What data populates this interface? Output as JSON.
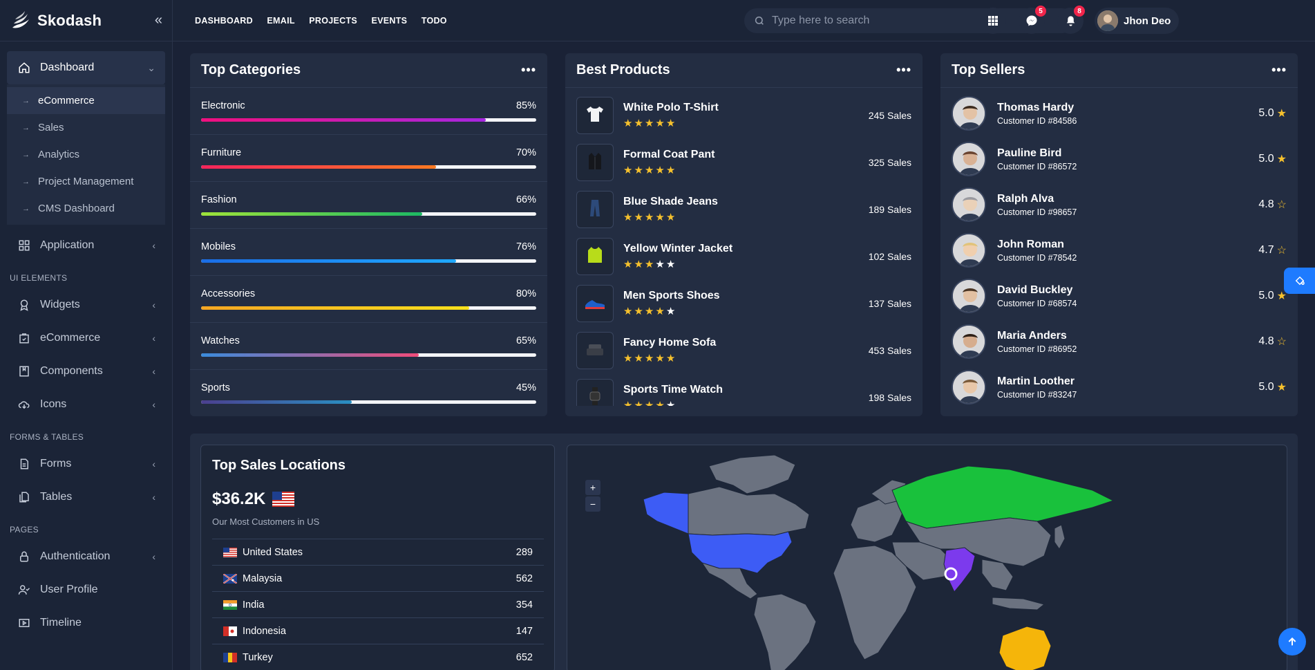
{
  "brand": {
    "name": "Skodash"
  },
  "header": {
    "nav": [
      "DASHBOARD",
      "EMAIL",
      "PROJECTS",
      "EVENTS",
      "TODO"
    ],
    "search_placeholder": "Type here to search",
    "user_name": "Jhon Deo",
    "messages_badge": "5",
    "notifications_badge": "8"
  },
  "sidebar": {
    "dashboard": "Dashboard",
    "dashboard_sub": [
      "eCommerce",
      "Sales",
      "Analytics",
      "Project Management",
      "CMS Dashboard"
    ],
    "application": "Application",
    "section_ui": "UI ELEMENTS",
    "widgets": "Widgets",
    "ecommerce": "eCommerce",
    "components": "Components",
    "icons": "Icons",
    "section_forms": "FORMS & TABLES",
    "forms": "Forms",
    "tables": "Tables",
    "section_pages": "PAGES",
    "authentication": "Authentication",
    "user_profile": "User Profile",
    "timeline": "Timeline"
  },
  "top_categories": {
    "title": "Top Categories",
    "items": [
      {
        "name": "Electronic",
        "pct": "85%",
        "value": 85,
        "gradient": "linear-gradient(90deg,#f10f7e,#a626e0)"
      },
      {
        "name": "Furniture",
        "pct": "70%",
        "value": 70,
        "gradient": "linear-gradient(90deg,#f3245b,#ff7a22)"
      },
      {
        "name": "Fashion",
        "pct": "66%",
        "value": 66,
        "gradient": "linear-gradient(90deg,#9ee33a,#1db964)"
      },
      {
        "name": "Mobiles",
        "pct": "76%",
        "value": 76,
        "gradient": "linear-gradient(90deg,#1a6de6,#1fa8ff)"
      },
      {
        "name": "Accessories",
        "pct": "80%",
        "value": 80,
        "gradient": "linear-gradient(90deg,#f5a623,#f6e01c)"
      },
      {
        "name": "Watches",
        "pct": "65%",
        "value": 65,
        "gradient": "linear-gradient(90deg,#3a8bdc,#f04c7a)"
      },
      {
        "name": "Sports",
        "pct": "45%",
        "value": 45,
        "gradient": "linear-gradient(90deg,#4b3f8f,#2a8fc2)"
      }
    ]
  },
  "best_products": {
    "title": "Best Products",
    "items": [
      {
        "name": "White Polo T-Shirt",
        "sales": "245 Sales",
        "stars": 5,
        "icon": "tshirt-icon"
      },
      {
        "name": "Formal Coat Pant",
        "sales": "325 Sales",
        "stars": 5,
        "icon": "coat-icon"
      },
      {
        "name": "Blue Shade Jeans",
        "sales": "189 Sales",
        "stars": 5,
        "icon": "jeans-icon"
      },
      {
        "name": "Yellow Winter Jacket",
        "sales": "102 Sales",
        "stars": 3,
        "icon": "jacket-icon"
      },
      {
        "name": "Men Sports Shoes",
        "sales": "137 Sales",
        "stars": 4,
        "icon": "shoe-icon"
      },
      {
        "name": "Fancy Home Sofa",
        "sales": "453 Sales",
        "stars": 5,
        "icon": "sofa-icon"
      },
      {
        "name": "Sports Time Watch",
        "sales": "198 Sales",
        "stars": 4,
        "icon": "watch-icon"
      }
    ]
  },
  "top_sellers": {
    "title": "Top Sellers",
    "items": [
      {
        "name": "Thomas Hardy",
        "id": "Customer ID #84586",
        "rating": "5.0",
        "half": false
      },
      {
        "name": "Pauline Bird",
        "id": "Customer ID #86572",
        "rating": "5.0",
        "half": false
      },
      {
        "name": "Ralph Alva",
        "id": "Customer ID #98657",
        "rating": "4.8",
        "half": true
      },
      {
        "name": "John Roman",
        "id": "Customer ID #78542",
        "rating": "4.7",
        "half": true
      },
      {
        "name": "David Buckley",
        "id": "Customer ID #68574",
        "rating": "5.0",
        "half": false
      },
      {
        "name": "Maria Anders",
        "id": "Customer ID #86952",
        "rating": "4.8",
        "half": true
      },
      {
        "name": "Martin Loother",
        "id": "Customer ID #83247",
        "rating": "5.0",
        "half": false
      }
    ]
  },
  "sales_locations": {
    "title": "Top Sales Locations",
    "amount": "$36.2K",
    "subtitle": "Our Most Customers in US",
    "rows": [
      {
        "country": "United States",
        "value": "289",
        "flag": "us"
      },
      {
        "country": "Malaysia",
        "value": "562",
        "flag": "my"
      },
      {
        "country": "India",
        "value": "354",
        "flag": "in"
      },
      {
        "country": "Indonesia",
        "value": "147",
        "flag": "id"
      },
      {
        "country": "Turkey",
        "value": "652",
        "flag": "tr"
      }
    ]
  },
  "map": {
    "zoom_in": "+",
    "zoom_out": "−"
  },
  "colors": {
    "accent": "#1e7bff",
    "star": "#f6c12d",
    "badge": "#f1254b"
  }
}
